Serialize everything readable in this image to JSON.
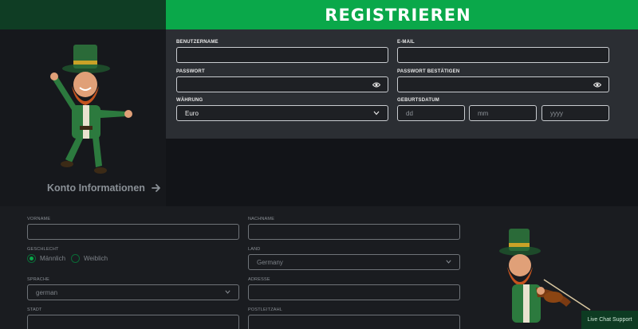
{
  "banner": {
    "title": "REGISTRIEREN"
  },
  "left_panel": {
    "konto_link": "Konto Informationen"
  },
  "form": {
    "username_label": "BENUTZERNAME",
    "email_label": "E-MAIL",
    "password_label": "PASSWORT",
    "password_confirm_label": "PASSWORT BESTÄTIGEN",
    "currency_label": "WÄHRUNG",
    "currency_value": "Euro",
    "birthdate_label": "GEBURTSDATUM",
    "day_placeholder": "dd",
    "month_placeholder": "mm",
    "year_placeholder": "yyyy"
  },
  "personal": {
    "firstname_label": "VORNAME",
    "lastname_label": "NACHNAME",
    "gender_label": "GESCHLECHT",
    "gender_options": [
      "Männlich",
      "Weiblich"
    ],
    "gender_selected": "Männlich",
    "country_label": "LAND",
    "country_value": "Germany",
    "language_label": "SPRACHE",
    "language_value": "german",
    "address_label": "ADRESSE",
    "city_label": "STADT",
    "postcode_label": "POSTLEITZAHL"
  },
  "chat": {
    "label": "Live Chat Support"
  },
  "colors": {
    "accent": "#0aa84a",
    "dark_green": "#0f3d24",
    "panel": "#2b2e33",
    "background": "#121418"
  }
}
